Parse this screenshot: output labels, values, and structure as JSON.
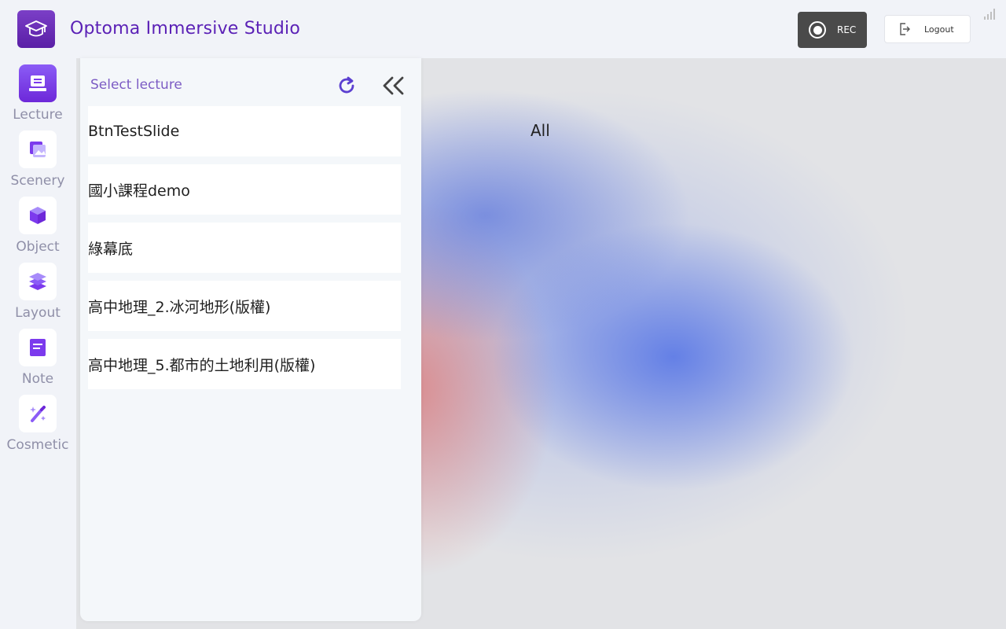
{
  "header": {
    "app_title": "Optoma Immersive Studio",
    "rec_label": "REC",
    "logout_label": "Logout"
  },
  "sidebar": {
    "items": [
      {
        "label": "Lecture",
        "icon": "lecture-icon",
        "active": true
      },
      {
        "label": "Scenery",
        "icon": "scenery-icon",
        "active": false
      },
      {
        "label": "Object",
        "icon": "object-icon",
        "active": false
      },
      {
        "label": "Layout",
        "icon": "layout-icon",
        "active": false
      },
      {
        "label": "Note",
        "icon": "note-icon",
        "active": false
      },
      {
        "label": "Cosmetic",
        "icon": "cosmetic-icon",
        "active": false
      }
    ]
  },
  "lecture_panel": {
    "title": "Select lecture",
    "lectures": [
      "BtnTestSlide",
      "國小課程demo",
      "綠幕底",
      "高中地理_2.冰河地形(版權)",
      "高中地理_5.都市的土地利用(版權)"
    ]
  },
  "main": {
    "filter_label": "All"
  },
  "colors": {
    "accent": "#6d28d9",
    "title": "#5b21b6",
    "rec_bg": "#4a4a4a"
  }
}
